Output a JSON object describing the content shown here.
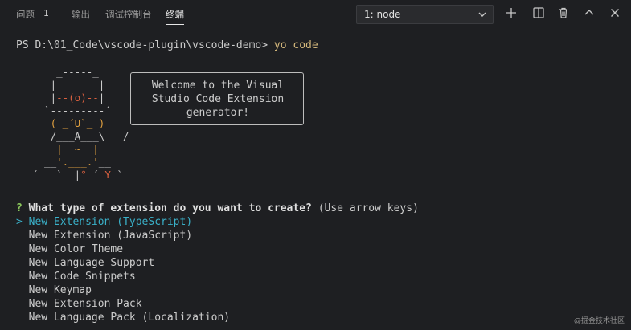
{
  "tabs": [
    {
      "label": "问题",
      "badge": "1"
    },
    {
      "label": "输出"
    },
    {
      "label": "调试控制台"
    },
    {
      "label": "终端"
    }
  ],
  "terminal_select": {
    "value": "1: node"
  },
  "icons": [
    "chevron-down-icon",
    "plus-icon",
    "split-icon",
    "trash-icon",
    "chevron-up-icon",
    "close-icon"
  ],
  "prompt": {
    "path": "PS D:\\01_Code\\vscode-plugin\\vscode-demo> ",
    "command": "yo code"
  },
  "yeoman": {
    "welcome_lines": [
      "Welcome to the Visual",
      "Studio Code Extension",
      "generator!"
    ]
  },
  "question": {
    "mark": "?",
    "text": "What type of extension do you want to create?",
    "hint": "(Use arrow keys)"
  },
  "choices": [
    "New Extension (TypeScript)",
    "New Extension (JavaScript)",
    "New Color Theme",
    "New Language Support",
    "New Code Snippets",
    "New Keymap",
    "New Extension Pack",
    "New Language Pack (Localization)"
  ],
  "selected_pointer": ">",
  "watermark": "@掘金技术社区",
  "colors": {
    "background": "#1e1f22",
    "question_mark": "#8ac65c",
    "selected": "#3ab0c8",
    "command": "#d7ba7d",
    "yeoman_accent": "#e0a040"
  }
}
